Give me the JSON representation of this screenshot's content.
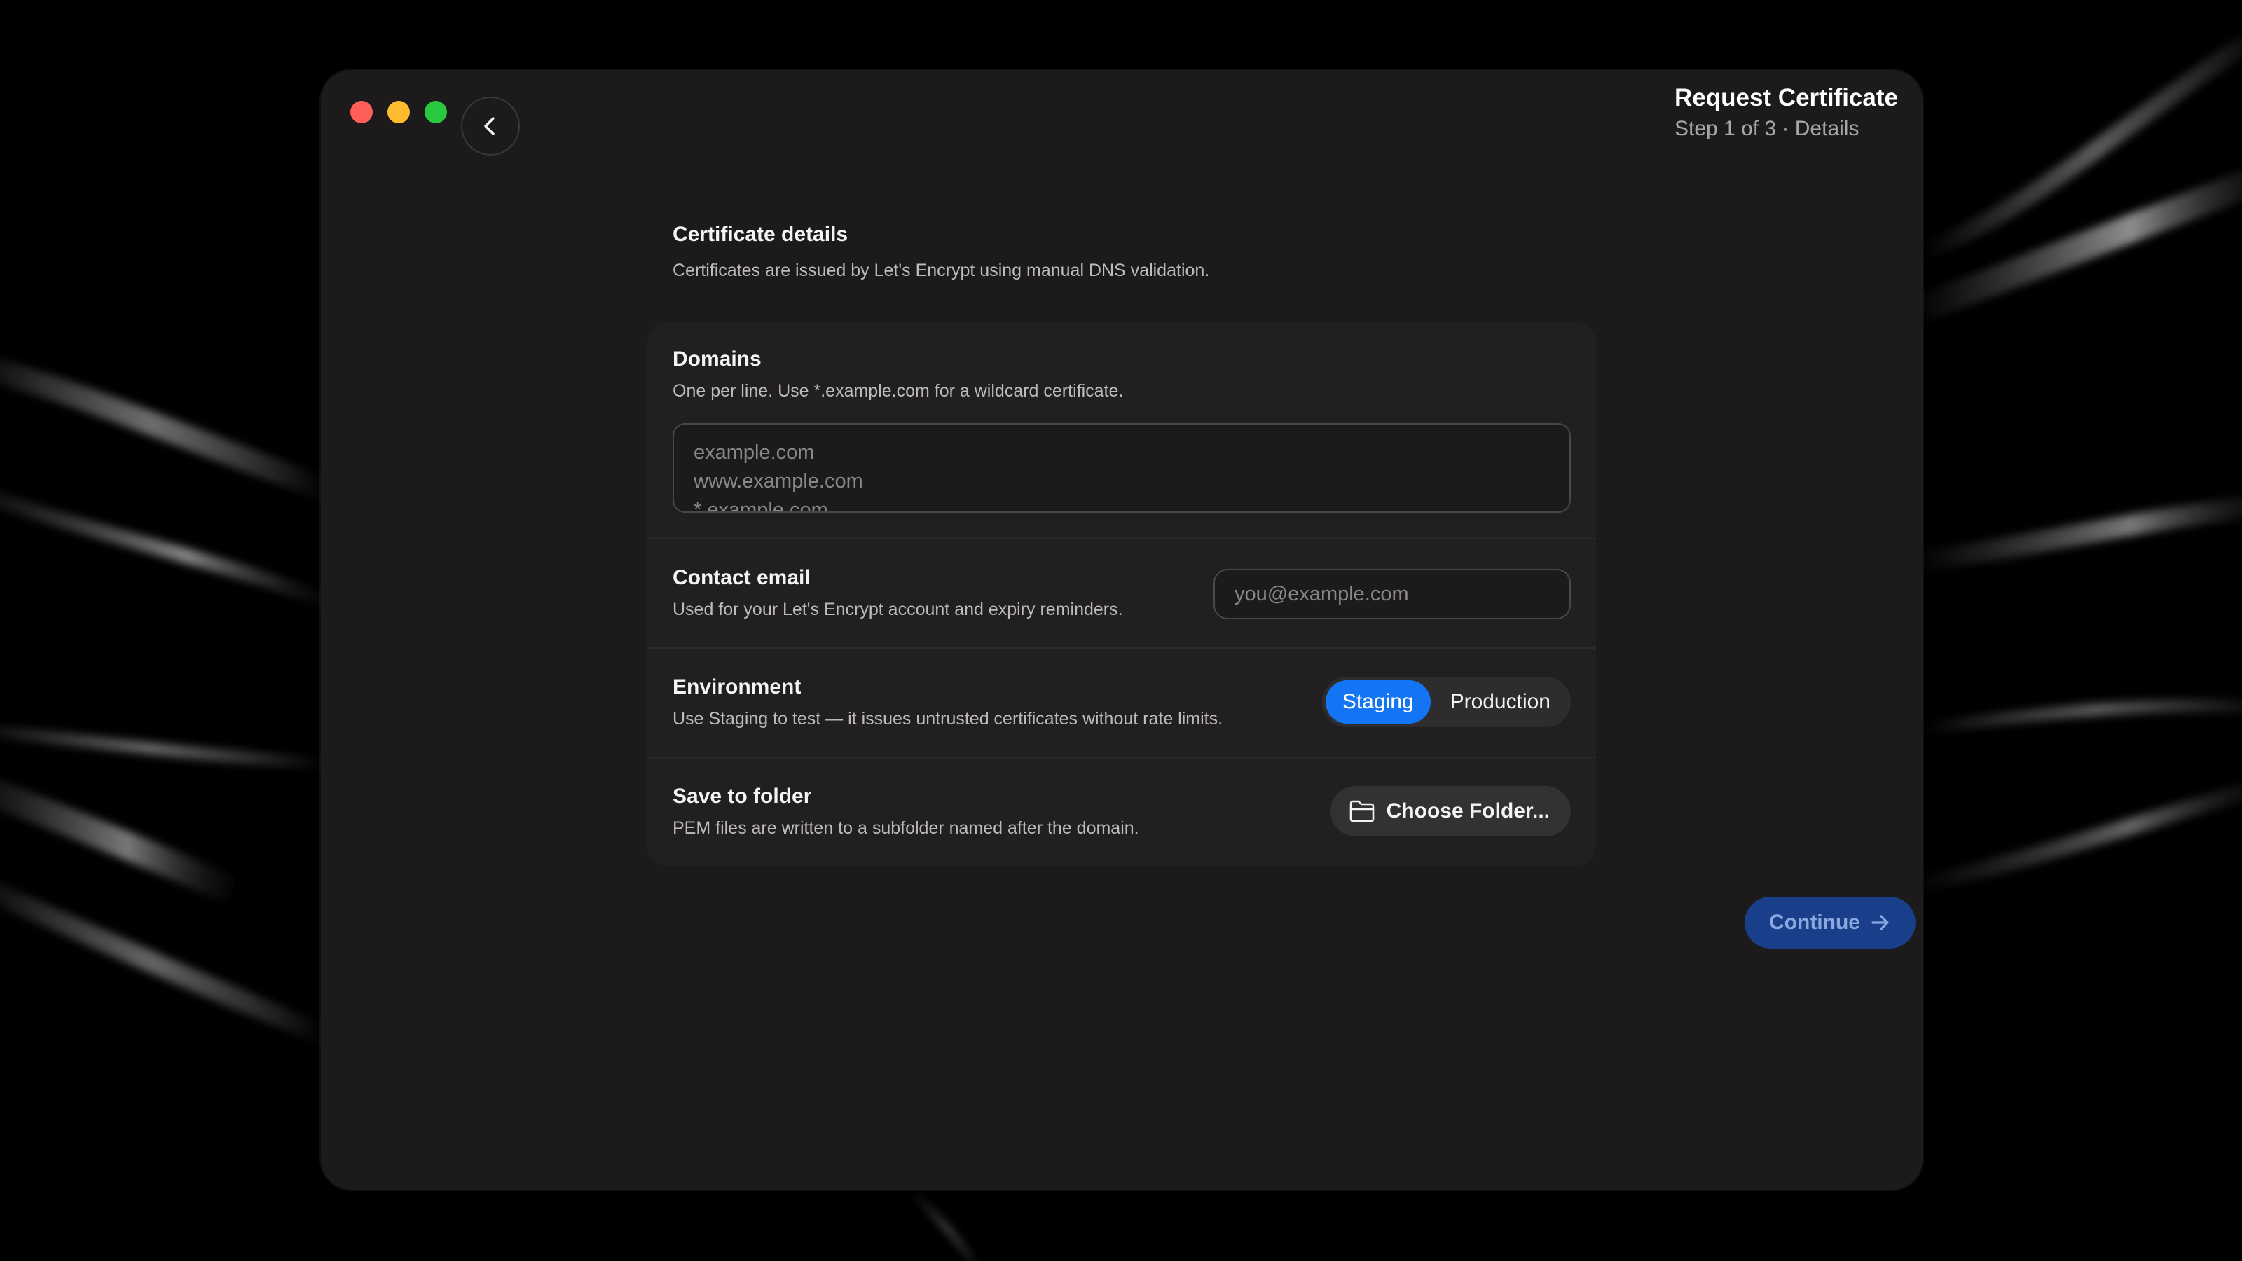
{
  "window": {
    "title": "Request Certificate",
    "subtitle": "Step 1 of 3 · Details"
  },
  "intro": {
    "title": "Certificate details",
    "description": "Certificates are issued by Let's Encrypt using manual DNS validation."
  },
  "domains": {
    "title": "Domains",
    "description": "One per line. Use *.example.com for a wildcard certificate.",
    "value": "",
    "placeholder_lines": [
      "example.com",
      "www.example.com",
      "*.example.com"
    ]
  },
  "email": {
    "title": "Contact email",
    "description": "Used for your Let's Encrypt account and expiry reminders.",
    "value": "",
    "placeholder": "you@example.com"
  },
  "environment": {
    "title": "Environment",
    "description": "Use Staging to test — it issues untrusted certificates without rate limits.",
    "options": [
      "Staging",
      "Production"
    ],
    "selected": "Staging"
  },
  "folder": {
    "title": "Save to folder",
    "description": "PEM files are written to a subfolder named after the domain.",
    "button_label": "Choose Folder..."
  },
  "continue_label": "Continue",
  "colors": {
    "accent": "#1374f4",
    "continue_disabled_bg": "#1a3f8a",
    "window_bg": "#1c1a1a",
    "panel_bg": "#211f1f"
  },
  "icons": [
    "chevron-left-icon",
    "folder-icon",
    "arrow-right-icon"
  ]
}
